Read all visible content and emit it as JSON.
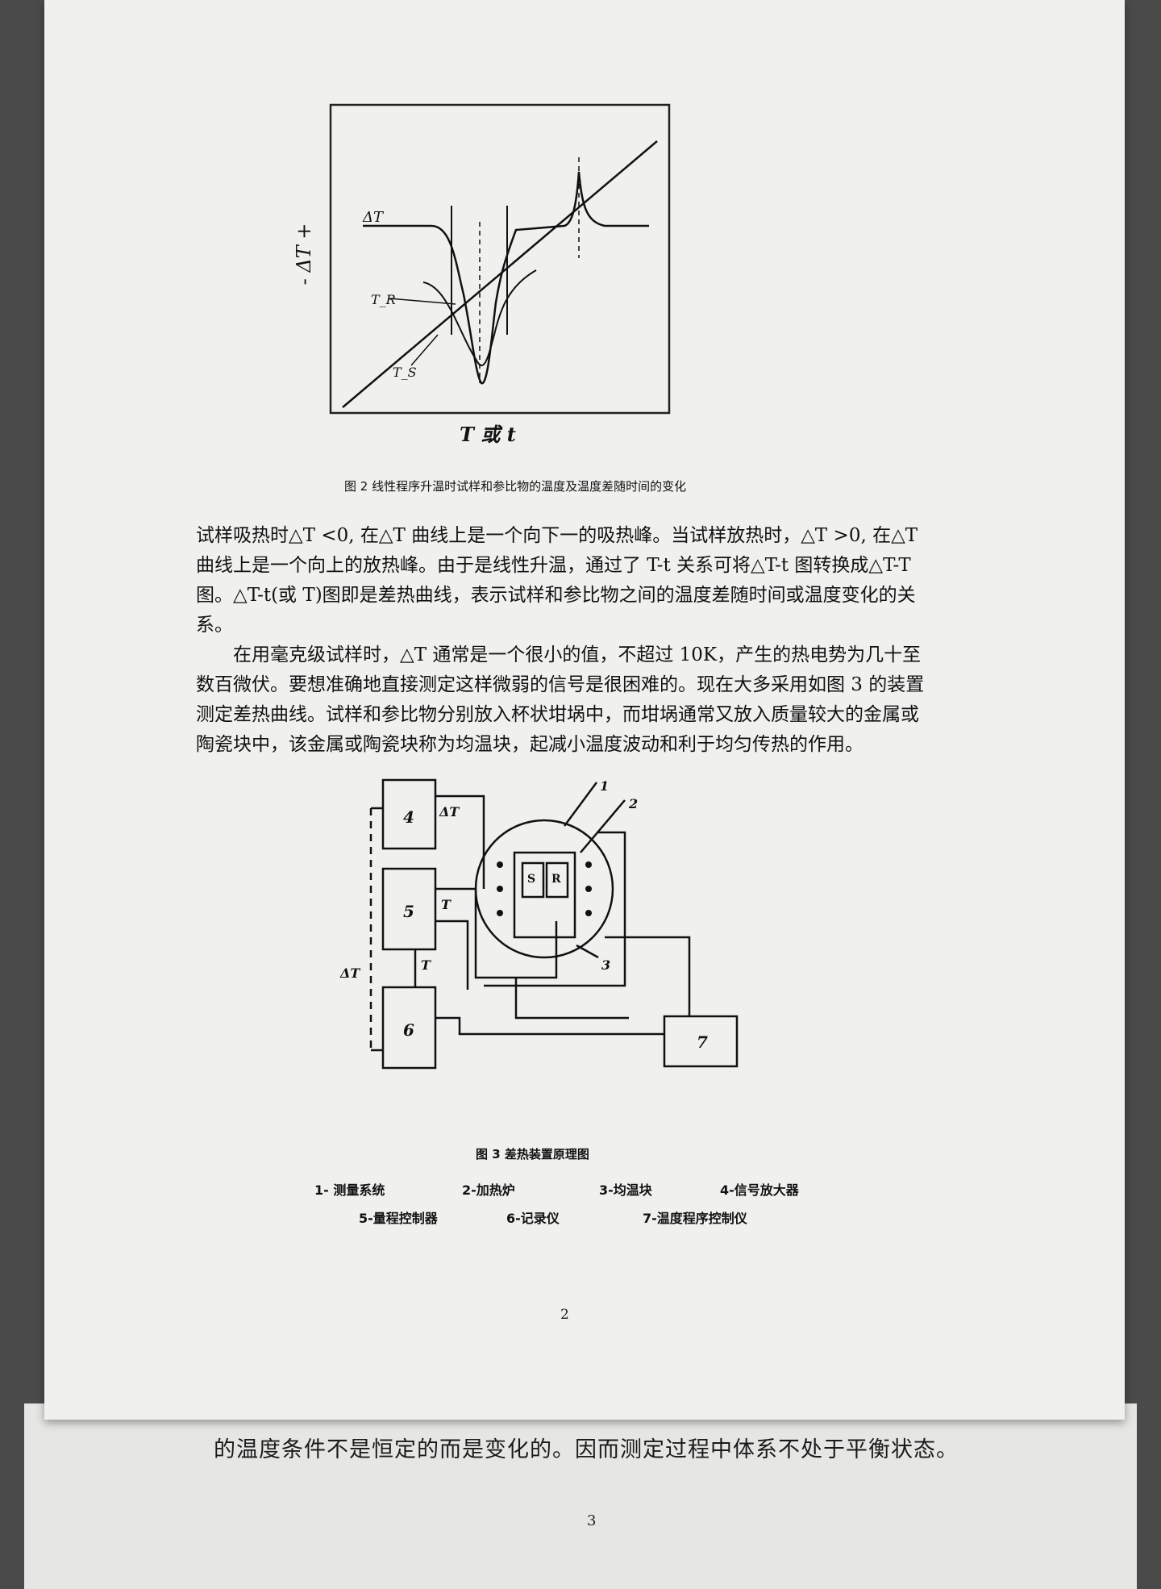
{
  "figure2": {
    "y_label": "- ΔT +",
    "delta_t_label": "ΔT",
    "tr_label": "T_R",
    "ts_label": "T_S",
    "x_label": "T 或 t",
    "caption": "图 2  线性程序升温时试样和参比物的温度及温度差随时间的变化"
  },
  "body": {
    "paragraph1": "试样吸热时△T <0, 在△T 曲线上是一个向下一的吸热峰。当试样放热时，△T >0, 在△T 曲线上是一个向上的放热峰。由于是线性升温，通过了 T-t 关系可将△T-t 图转换成△T-T 图。△T-t(或 T)图即是差热曲线，表示试样和参比物之间的温度差随时间或温度变化的关系。",
    "paragraph2": "在用毫克级试样时，△T 通常是一个很小的值，不超过 10K，产生的热电势为几十至数百微伏。要想准确地直接测定这样微弱的信号是很困难的。现在大多采用如图 3 的装置测定差热曲线。试样和参比物分别放入杯状坩埚中，而坩埚通常又放入质量较大的金属或陶瓷块中，该金属或陶瓷块称为均温块，起减小温度波动和利于均匀传热的作用。"
  },
  "figure3": {
    "box4": "4",
    "box5": "5",
    "box6": "6",
    "box7": "7",
    "label_dt_top": "ΔT",
    "label_t1": "T",
    "label_t2": "T",
    "label_dt_left": "ΔT",
    "label_s": "S",
    "label_r": "R",
    "callout1": "1",
    "callout2": "2",
    "callout3": "3",
    "caption": "图 3  差热装置原理图"
  },
  "legend": {
    "item1": "1-   测量系统",
    "item2": "2-加热炉",
    "item3": "3-均温块",
    "item4": "4-信号放大器",
    "item5": "5-量程控制器",
    "item6": "6-记录仪",
    "item7": "7-温度程序控制仪"
  },
  "page_number": "2",
  "next_page": {
    "text": "的温度条件不是恒定的而是变化的。因而测定过程中体系不处于平衡状态。",
    "page_number": "3"
  }
}
